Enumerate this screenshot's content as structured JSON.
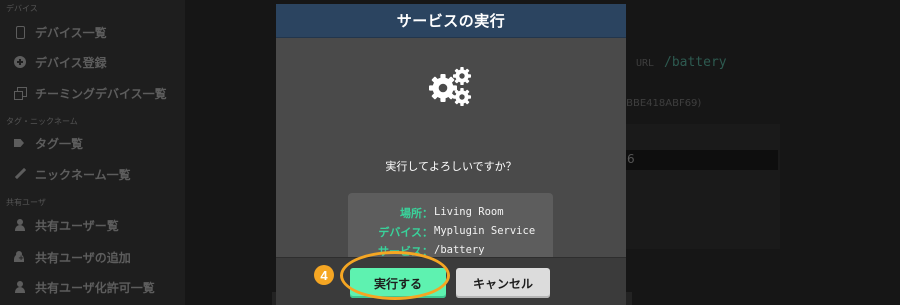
{
  "sidebar": {
    "section_device": "デバイス",
    "section_tag": "タグ・ニックネーム",
    "section_shared": "共有ユーザ",
    "items": [
      {
        "label": "デバイス一覧",
        "icon": "phone-icon"
      },
      {
        "label": "デバイス登録",
        "icon": "plus-circle-icon"
      },
      {
        "label": "チーミングデバイス一覧",
        "icon": "copy-icon"
      },
      {
        "label": "タグ一覧",
        "icon": "tags-icon"
      },
      {
        "label": "ニックネーム一覧",
        "icon": "pencil-icon"
      },
      {
        "label": "共有ユーザー覧",
        "icon": "user-icon"
      },
      {
        "label": "共有ユーザの追加",
        "icon": "user-add-icon"
      },
      {
        "label": "共有ユーザ化許可一覧",
        "icon": "user-icon"
      }
    ]
  },
  "background": {
    "url_label": "URL",
    "url_value": "/battery",
    "device_id_fragment": "F3BBE418ABF69)",
    "value_fragment": "6"
  },
  "modal": {
    "title": "サービスの実行",
    "question": "実行してよろしいですか？",
    "info": [
      {
        "label": "場所：",
        "value": "Living Room"
      },
      {
        "label": "デバイス：",
        "value": "Myplugin Service"
      },
      {
        "label": "サービス：",
        "value": "/battery"
      }
    ],
    "run_button": "実行する",
    "cancel_button": "キャンセル"
  },
  "annotation": {
    "step_number": "4",
    "color": "#f5a623"
  },
  "colors": {
    "header": "#2b4460",
    "accent": "#5ef2b0",
    "label_green": "#39d39b",
    "modal_bg": "#4a4a4a"
  }
}
